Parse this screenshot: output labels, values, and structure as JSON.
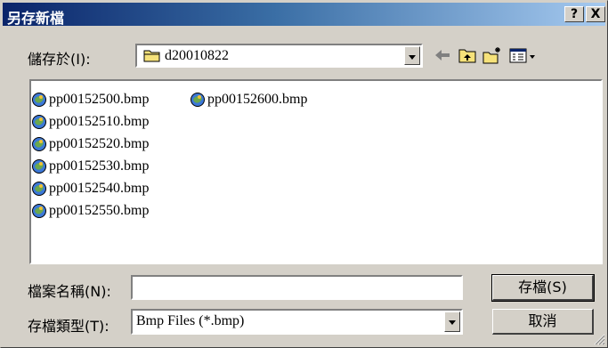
{
  "window": {
    "title": "另存新檔",
    "help_button": "?",
    "close_button": "X"
  },
  "location": {
    "label": "儲存於(I):",
    "value": "d20010822"
  },
  "toolbar": {
    "back_icon": "back-arrow-icon",
    "up_icon": "up-folder-icon",
    "new_folder_icon": "new-folder-icon",
    "view_icon": "view-menu-icon"
  },
  "files": [
    "pp00152500.bmp",
    "pp00152510.bmp",
    "pp00152520.bmp",
    "pp00152530.bmp",
    "pp00152540.bmp",
    "pp00152550.bmp",
    "pp00152600.bmp"
  ],
  "filename": {
    "label": "檔案名稱(N):",
    "value": ""
  },
  "filetype": {
    "label": "存檔類型(T):",
    "value": "Bmp Files (*.bmp)"
  },
  "buttons": {
    "save": "存檔(S)",
    "cancel": "取消"
  },
  "colors": {
    "title_start": "#0a246a",
    "title_end": "#a6caf0",
    "face": "#d4d0c8"
  }
}
